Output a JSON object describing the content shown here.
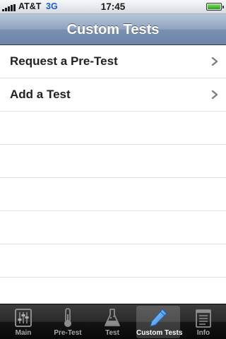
{
  "status_bar": {
    "carrier": "AT&T",
    "network": "3G",
    "time": "17:45"
  },
  "nav_bar": {
    "title": "Custom Tests"
  },
  "table": {
    "rows": [
      {
        "label": "Request a Pre-Test"
      },
      {
        "label": "Add a Test"
      }
    ]
  },
  "tab_bar": {
    "selected": "Custom Tests",
    "tabs": [
      {
        "label": "Main",
        "icon": "sliders-icon"
      },
      {
        "label": "Pre-Test",
        "icon": "thermometer-icon"
      },
      {
        "label": "Test",
        "icon": "flask-icon"
      },
      {
        "label": "Custom Tests",
        "icon": "pencil-icon"
      },
      {
        "label": "Info",
        "icon": "notepad-icon"
      }
    ]
  },
  "colors": {
    "nav_bar": "#7a90b1",
    "tab_bar": "#151515",
    "network_text": "#1a5fd0",
    "battery_fill": "#2f9b1f"
  }
}
